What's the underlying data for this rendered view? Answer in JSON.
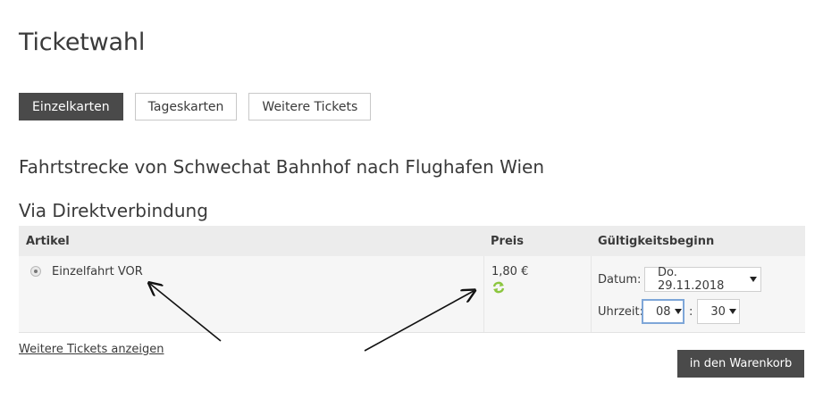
{
  "page": {
    "title": "Ticketwahl"
  },
  "tabs": [
    {
      "label": "Einzelkarten",
      "active": true
    },
    {
      "label": "Tageskarten",
      "active": false
    },
    {
      "label": "Weitere Tickets",
      "active": false
    }
  ],
  "route": {
    "title": "Fahrtstrecke von Schwechat Bahnhof nach Flughafen Wien",
    "via": "Via Direktverbindung"
  },
  "table": {
    "headers": {
      "artikel": "Artikel",
      "preis": "Preis",
      "gueltig": "Gültigkeitsbeginn"
    },
    "rows": [
      {
        "ticket": "Einzelfahrt VOR",
        "price": "1,80 €",
        "datum_label": "Datum:",
        "datum_value": "Do. 29.11.2018",
        "uhrzeit_label": "Uhrzeit:",
        "hour": "08",
        "minute": "30",
        "time_separator": ":"
      }
    ]
  },
  "links": {
    "more_tickets": "Weitere Tickets anzeigen"
  },
  "actions": {
    "cart": "in den Warenkorb"
  },
  "colors": {
    "accent_dark": "#4a4a4a",
    "refresh_green": "#8cc63f",
    "focus_border": "#7ea6d8"
  },
  "icons": {
    "refresh": "refresh-icon",
    "caret": "chevron-down-icon",
    "radio": "radio-selected"
  }
}
